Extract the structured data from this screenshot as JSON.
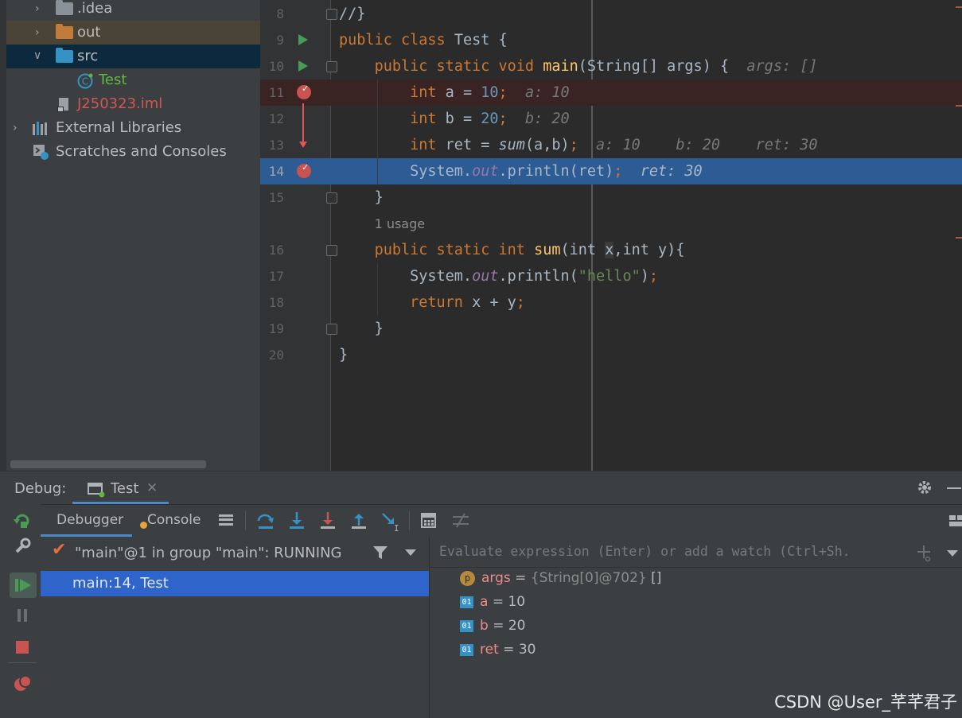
{
  "project_tree": {
    "items": [
      {
        "label": ".idea",
        "type": "folder"
      },
      {
        "label": "out",
        "type": "folder"
      },
      {
        "label": "src",
        "type": "folder"
      },
      {
        "label": "Test",
        "type": "class"
      },
      {
        "label": "J250323.iml",
        "type": "file"
      },
      {
        "label": "External Libraries",
        "type": "libraries"
      },
      {
        "label": "Scratches and Consoles",
        "type": "scratches"
      }
    ]
  },
  "editor": {
    "lines": [
      {
        "n": "8"
      },
      {
        "n": "9"
      },
      {
        "n": "10"
      },
      {
        "n": "11"
      },
      {
        "n": "12"
      },
      {
        "n": "13"
      },
      {
        "n": "14"
      },
      {
        "n": "15"
      },
      {
        "n": "16"
      },
      {
        "n": "17"
      },
      {
        "n": "18"
      },
      {
        "n": "19"
      },
      {
        "n": "20"
      }
    ],
    "code": {
      "l8": "//}",
      "kw_public": "public",
      "kw_class": "class",
      "class_name": "Test",
      "brace_open": "{",
      "kw_static": "static",
      "kw_void": "void",
      "fn_main": "main",
      "main_params": "(String[] args) {",
      "hint_args": "args: []",
      "kw_int": "int",
      "a_decl": "a = ",
      "num_10": "10",
      "semi": ";",
      "hint_a": "a: 10",
      "b_decl": "b = ",
      "num_20": "20",
      "hint_b": "b: 20",
      "ret_decl": "ret = ",
      "fn_sum_call": "sum",
      "sum_args": "(a,b)",
      "hint_ret_a": "a: 10",
      "hint_ret_b": "b: 20",
      "hint_ret_ret": "ret: 30",
      "system": "System.",
      "out": "out",
      "println_ret": ".println(ret)",
      "hint_print": "ret: 30",
      "brace_close": "}",
      "usage": "1 usage",
      "fn_sum": "sum",
      "sum_params_1": "(int ",
      "param_x": "x",
      "sum_params_2": ",int y){",
      "println_hello_1": ".println(",
      "hello": "\"hello\"",
      "println_hello_2": ")",
      "kw_return": "return",
      "return_expr": " x + y"
    }
  },
  "debug": {
    "title": "Debug:",
    "tab": "Test",
    "tabs": {
      "debugger": "Debugger",
      "console": "Console"
    },
    "thread": "\"main\"@1 in group \"main\": RUNNING",
    "frame": "main:14, Test",
    "evaluate_placeholder": "Evaluate expression (Enter) or add a watch (Ctrl+Sh.",
    "variables": [
      {
        "icon": "p",
        "name": "args",
        "type": "{String[0]@702}",
        "value": "[]"
      },
      {
        "icon": "01",
        "name": "a",
        "value": "10"
      },
      {
        "icon": "01",
        "name": "b",
        "value": "20"
      },
      {
        "icon": "01",
        "name": "ret",
        "value": "30"
      }
    ]
  },
  "watermark": "CSDN @User_芊芊君子"
}
